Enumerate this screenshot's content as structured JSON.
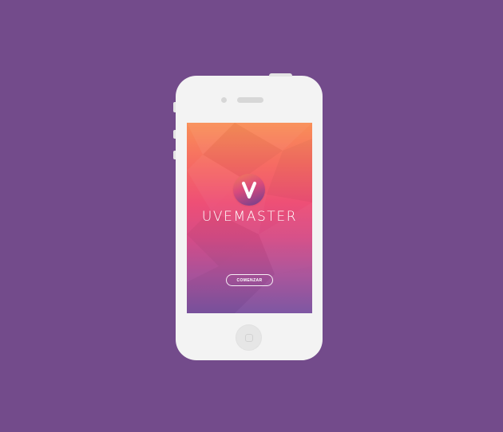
{
  "app": {
    "brand_name": "UVEMASTER",
    "logo_letter": "V",
    "start_button_label": "COMENZAR"
  },
  "colors": {
    "background": "#734b8b",
    "phone_body": "#f3f3f3",
    "screen_gradient_top": "#f98f57",
    "screen_gradient_mid": "#ee4f76",
    "screen_gradient_bottom": "#7b53a0",
    "text": "#ffffff"
  },
  "icons": {
    "logo": "v-logo-icon",
    "camera": "camera-icon",
    "speaker": "speaker-icon",
    "home": "home-button-icon"
  }
}
